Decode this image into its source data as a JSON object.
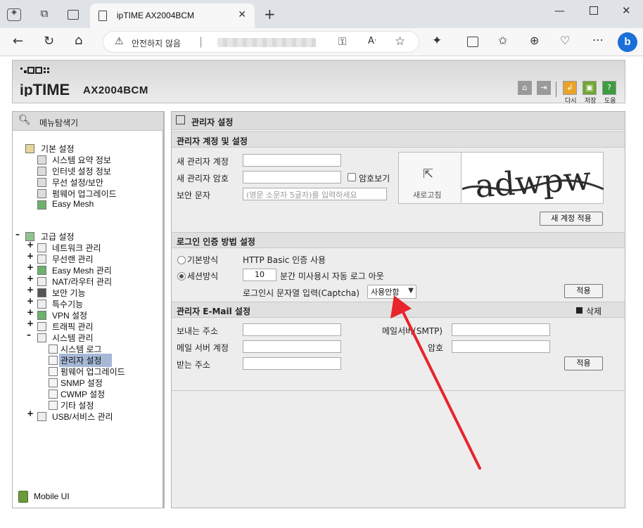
{
  "browser": {
    "tab_title": "ipTIME AX2004BCM",
    "insecure_label": "안전하지 않음",
    "new_tab": "+"
  },
  "router": {
    "model": "AX2004BCM",
    "header_buttons": [
      {
        "label": "다시",
        "color": "#e8a428"
      },
      {
        "label": "저장",
        "color": "#6fa832"
      },
      {
        "label": "도움",
        "color": "#3d9c3d"
      }
    ]
  },
  "menu": {
    "title": "메뉴탐색기",
    "basic": {
      "label": "기본 설정",
      "items": [
        "시스템 요약 정보",
        "인터넷 설정 정보",
        "무선 설정/보안",
        "펌웨어 업그레이드",
        "Easy Mesh"
      ]
    },
    "advanced": {
      "label": "고급 설정",
      "items": [
        "네트워크 관리",
        "무선랜 관리",
        "Easy Mesh 관리",
        "NAT/라우터 관리",
        "보안 기능",
        "특수기능",
        "VPN 설정",
        "트래픽 관리",
        "시스템 관리"
      ],
      "system_items": [
        "시스템 로그",
        "관리자 설정",
        "펌웨어 업그레이드",
        "SNMP 설정",
        "CWMP 설정",
        "기타 설정"
      ],
      "usb": "USB/서비스 관리"
    },
    "mobile": "Mobile UI"
  },
  "admin": {
    "title": "관리자 설정",
    "account": {
      "title": "관리자 계정 및 설정",
      "new_id_label": "새 관리자 계정",
      "new_pw_label": "새 관리자 암호",
      "show_pw": "암호보기",
      "captcha_label": "보안 문자",
      "captcha_placeholder": "(영문 소문자 5글자)를 입력하세요",
      "refresh": "새로고침",
      "captcha_text": "adwpw",
      "apply": "새 계정 적용"
    },
    "login": {
      "title": "로그인 인증 방법 설정",
      "basic_label": "기본방식",
      "basic_desc": "HTTP Basic 인증 사용",
      "session_label": "세션방식",
      "session_minutes": "10",
      "session_desc": "분간 미사용시 자동 로그 아웃",
      "captcha_option_label": "로그인시 문자열 입력(Captcha)",
      "captcha_option_value": "사용안함",
      "apply": "적용"
    },
    "email": {
      "title": "관리자 E-Mail 설정",
      "delete": "삭제",
      "sender_label": "보내는 주소",
      "smtp_label": "메일서버(SMTP)",
      "account_label": "메일 서버 계정",
      "password_label": "암호",
      "receiver_label": "받는 주소",
      "apply": "적용"
    }
  },
  "annotation": {
    "arrow_color": "#e8242c"
  }
}
